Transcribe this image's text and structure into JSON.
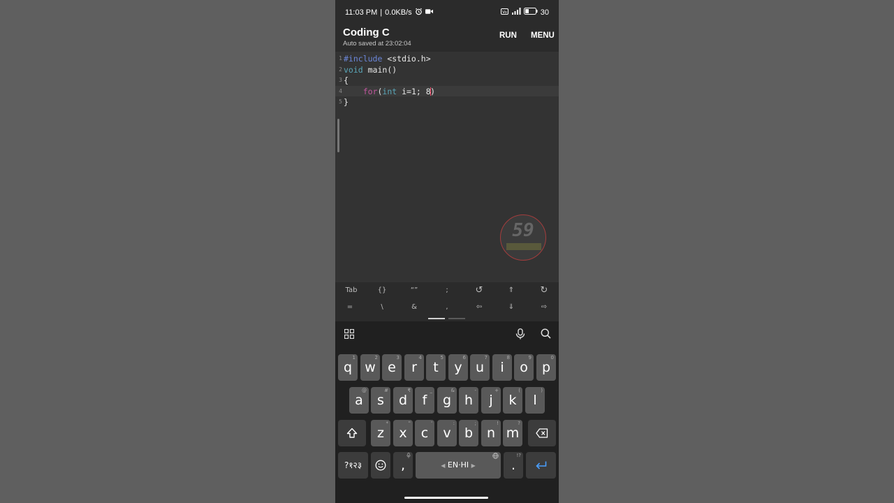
{
  "status_bar": {
    "time": "11:03 PM",
    "speed": "0.0KB/s",
    "battery": "30"
  },
  "app": {
    "title": "Coding C",
    "subtitle": "Auto saved at 23:02:04",
    "run_label": "RUN",
    "menu_label": "MENU"
  },
  "editor": {
    "line_numbers": [
      "1",
      "2",
      "3",
      "4",
      "5"
    ],
    "lines": [
      {
        "p1": "#include",
        "p2": " <stdio.h>"
      },
      {
        "p1": "void",
        "p2": " main()"
      },
      {
        "p1": "{"
      },
      {
        "indent": "    ",
        "kw": "for",
        "p1": "(",
        "ty": "int",
        "p2": " i=1; 8",
        "p3": ")"
      },
      {
        "p1": "}"
      }
    ],
    "active_line": 4
  },
  "watermark": {
    "number": "59"
  },
  "extra_keys": {
    "row1": [
      "Tab",
      "{}",
      "“”",
      ";",
      "↺",
      "⇑",
      "↻"
    ],
    "row2": [
      "=",
      "\\",
      "&",
      ",",
      "⇦",
      "⇓",
      "⇨"
    ]
  },
  "keyboard": {
    "row1": [
      {
        "key": "q",
        "hint": "1"
      },
      {
        "key": "w",
        "hint": "2"
      },
      {
        "key": "e",
        "hint": "3"
      },
      {
        "key": "r",
        "hint": "4"
      },
      {
        "key": "t",
        "hint": "5"
      },
      {
        "key": "y",
        "hint": "6"
      },
      {
        "key": "u",
        "hint": "7"
      },
      {
        "key": "i",
        "hint": "8"
      },
      {
        "key": "o",
        "hint": "9"
      },
      {
        "key": "p",
        "hint": "0"
      }
    ],
    "row2": [
      {
        "key": "a",
        "hint": "@"
      },
      {
        "key": "s",
        "hint": "#"
      },
      {
        "key": "d",
        "hint": "₹"
      },
      {
        "key": "f",
        "hint": "_"
      },
      {
        "key": "g",
        "hint": "&"
      },
      {
        "key": "h",
        "hint": "-"
      },
      {
        "key": "j",
        "hint": "+"
      },
      {
        "key": "k",
        "hint": "("
      },
      {
        "key": "l",
        "hint": ")"
      }
    ],
    "row3": [
      {
        "key": "z",
        "hint": "*"
      },
      {
        "key": "x",
        "hint": "\""
      },
      {
        "key": "c",
        "hint": "'"
      },
      {
        "key": "v",
        "hint": ":"
      },
      {
        "key": "b",
        "hint": ";"
      },
      {
        "key": "n",
        "hint": "!"
      },
      {
        "key": "m",
        "hint": "?"
      }
    ],
    "symbols_label": "?१२३",
    "comma_label": ",",
    "space_label": "EN·HI",
    "period_label": ".",
    "period_hint": "!?"
  },
  "colors": {
    "keyword": "#c3569f",
    "preprocessor": "#6b86d9",
    "type": "#5aa6b8",
    "enter": "#4a9eff"
  }
}
